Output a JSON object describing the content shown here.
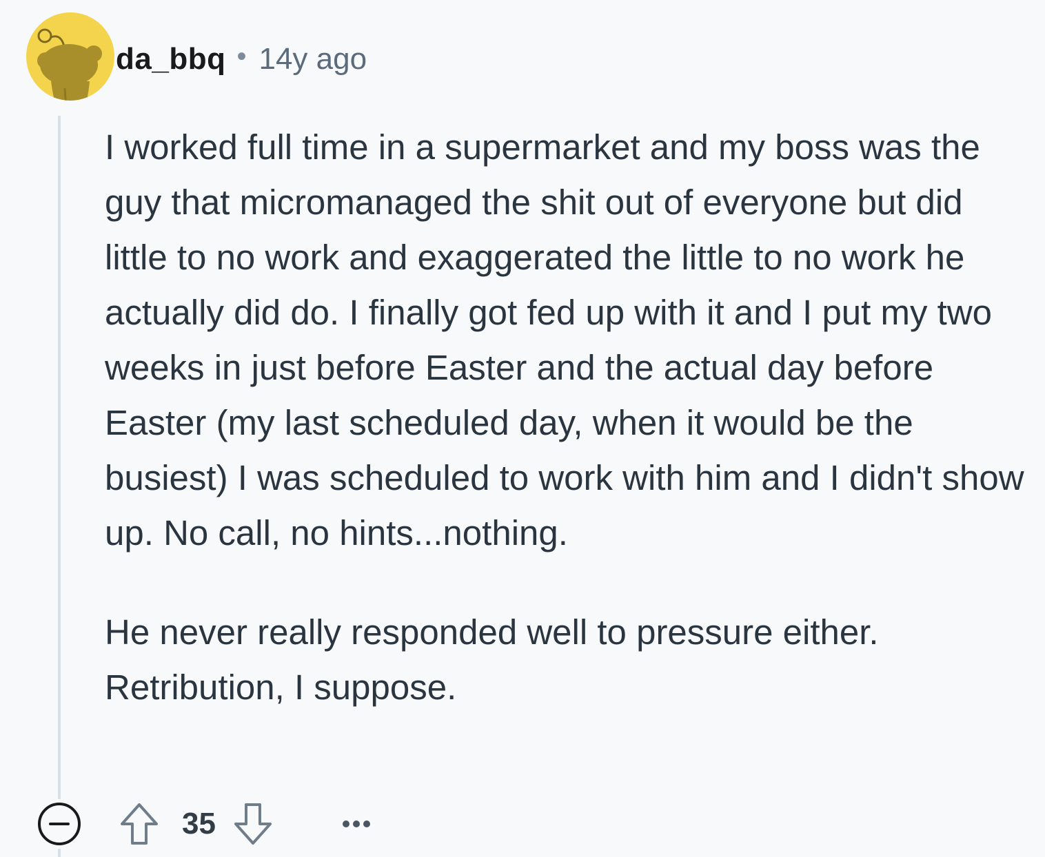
{
  "comment": {
    "username": "da_bbq",
    "separator": "•",
    "timestamp": "14y ago",
    "paragraphs": [
      "I worked full time in a supermarket and my boss was the guy that micromanaged the shit out of everyone but did little to no work and exaggerated the little to no work he actually did do. I finally got fed up with it and I put my two weeks in just before Easter and the actual day before Easter (my last scheduled day, when it would be the busiest) I was scheduled to work with him and I didn't show up. No call, no hints...nothing.",
      "He never really responded well to pressure either. Retribution, I suppose."
    ],
    "score": "35"
  },
  "colors": {
    "background": "#f7f9fb",
    "avatar_bg": "#f5d44d",
    "avatar_figure": "#a88f2c",
    "text": "#2a3540",
    "muted": "#5b6b7b",
    "thread_line": "#d8e0e8"
  },
  "icons": {
    "avatar": "snoo-avatar-icon",
    "collapse": "collapse-minus-icon",
    "upvote": "arrow-up-outline-icon",
    "downvote": "arrow-down-outline-icon",
    "more": "ellipsis-icon"
  }
}
